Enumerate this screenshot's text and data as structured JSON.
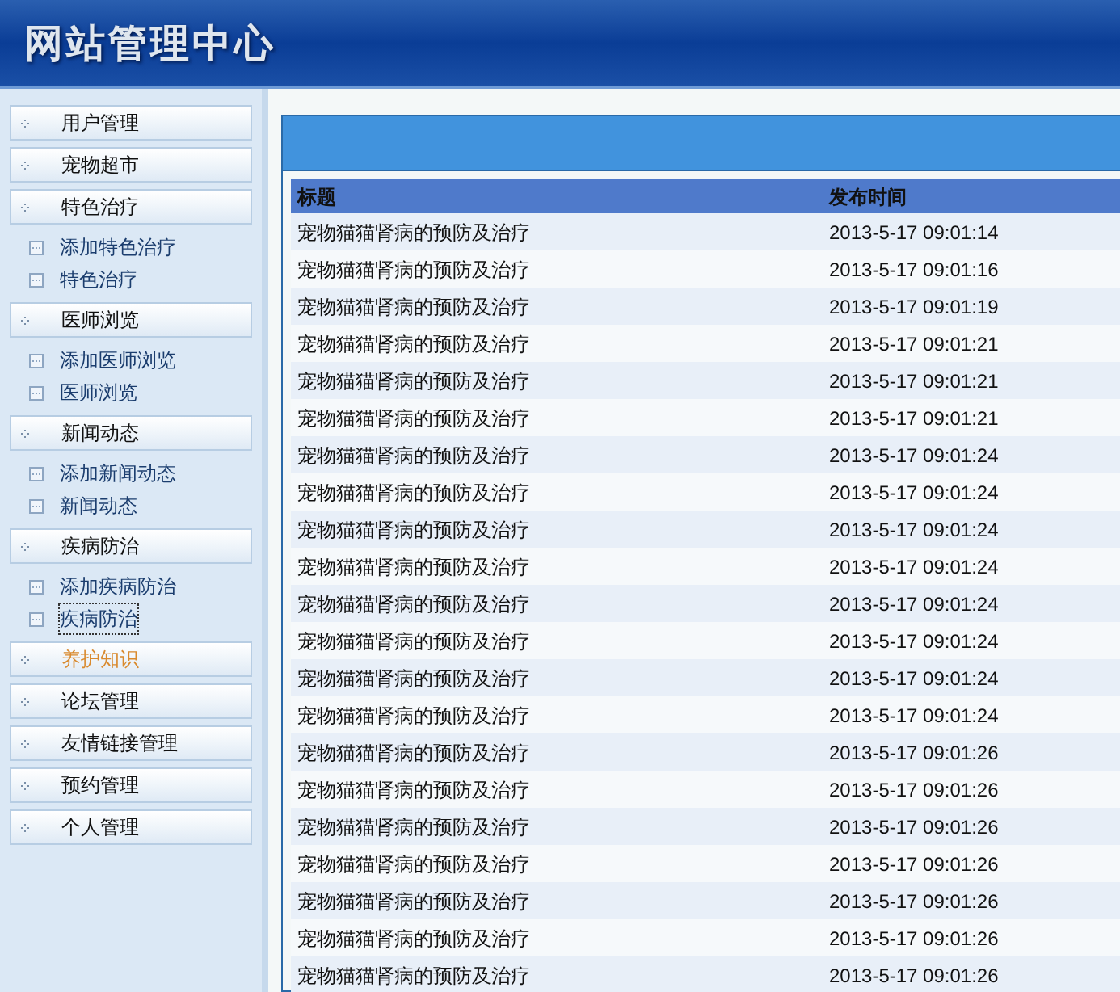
{
  "header": {
    "title": "网站管理中心"
  },
  "sidebar": {
    "groups": [
      {
        "label": "用户管理",
        "selected": false
      },
      {
        "label": "宠物超市",
        "selected": false
      },
      {
        "label": "特色治疗",
        "selected": false,
        "children": [
          {
            "label": "添加特色治疗",
            "focused": false
          },
          {
            "label": "特色治疗",
            "focused": false
          }
        ]
      },
      {
        "label": "医师浏览",
        "selected": false,
        "children": [
          {
            "label": "添加医师浏览",
            "focused": false
          },
          {
            "label": "医师浏览",
            "focused": false
          }
        ]
      },
      {
        "label": "新闻动态",
        "selected": false,
        "children": [
          {
            "label": "添加新闻动态",
            "focused": false
          },
          {
            "label": "新闻动态",
            "focused": false
          }
        ]
      },
      {
        "label": "疾病防治",
        "selected": false,
        "children": [
          {
            "label": "添加疾病防治",
            "focused": false
          },
          {
            "label": "疾病防治",
            "focused": true
          }
        ]
      },
      {
        "label": "养护知识",
        "selected": true
      },
      {
        "label": "论坛管理",
        "selected": false
      },
      {
        "label": "友情链接管理",
        "selected": false
      },
      {
        "label": "预约管理",
        "selected": false
      },
      {
        "label": "个人管理",
        "selected": false
      }
    ]
  },
  "table": {
    "columns": [
      "标题",
      "发布时间"
    ],
    "rows": [
      [
        "宠物猫猫肾病的预防及治疗",
        "2013-5-17 09:01:14"
      ],
      [
        "宠物猫猫肾病的预防及治疗",
        "2013-5-17 09:01:16"
      ],
      [
        "宠物猫猫肾病的预防及治疗",
        "2013-5-17 09:01:19"
      ],
      [
        "宠物猫猫肾病的预防及治疗",
        "2013-5-17 09:01:21"
      ],
      [
        "宠物猫猫肾病的预防及治疗",
        "2013-5-17 09:01:21"
      ],
      [
        "宠物猫猫肾病的预防及治疗",
        "2013-5-17 09:01:21"
      ],
      [
        "宠物猫猫肾病的预防及治疗",
        "2013-5-17 09:01:24"
      ],
      [
        "宠物猫猫肾病的预防及治疗",
        "2013-5-17 09:01:24"
      ],
      [
        "宠物猫猫肾病的预防及治疗",
        "2013-5-17 09:01:24"
      ],
      [
        "宠物猫猫肾病的预防及治疗",
        "2013-5-17 09:01:24"
      ],
      [
        "宠物猫猫肾病的预防及治疗",
        "2013-5-17 09:01:24"
      ],
      [
        "宠物猫猫肾病的预防及治疗",
        "2013-5-17 09:01:24"
      ],
      [
        "宠物猫猫肾病的预防及治疗",
        "2013-5-17 09:01:24"
      ],
      [
        "宠物猫猫肾病的预防及治疗",
        "2013-5-17 09:01:24"
      ],
      [
        "宠物猫猫肾病的预防及治疗",
        "2013-5-17 09:01:26"
      ],
      [
        "宠物猫猫肾病的预防及治疗",
        "2013-5-17 09:01:26"
      ],
      [
        "宠物猫猫肾病的预防及治疗",
        "2013-5-17 09:01:26"
      ],
      [
        "宠物猫猫肾病的预防及治疗",
        "2013-5-17 09:01:26"
      ],
      [
        "宠物猫猫肾病的预防及治疗",
        "2013-5-17 09:01:26"
      ],
      [
        "宠物猫猫肾病的预防及治疗",
        "2013-5-17 09:01:26"
      ],
      [
        "宠物猫猫肾病的预防及治疗",
        "2013-5-17 09:01:26"
      ]
    ]
  }
}
